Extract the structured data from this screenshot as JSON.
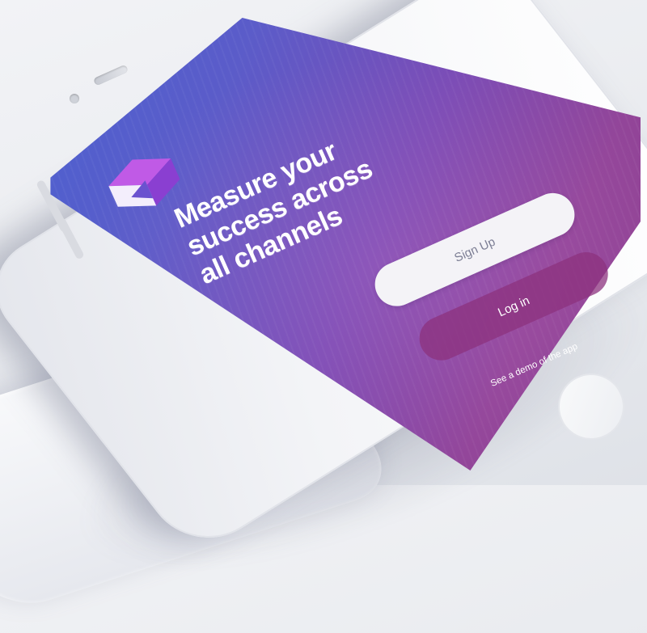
{
  "onboarding": {
    "headline_line1": "Measure your",
    "headline_line2": "success across",
    "headline_line3": "all channels",
    "signup_label": "Sign Up",
    "login_label": "Log in",
    "demo_link": "See a demo of the app"
  },
  "logo": {
    "name": "app-logo",
    "colors": {
      "light": "#ffffff",
      "top": "#c05ae6",
      "side": "#8a3fd1"
    }
  },
  "colors": {
    "gradient_start": "#4a62d1",
    "gradient_mid": "#7a4cb6",
    "gradient_end": "#8e3f8f",
    "signup_bg": "#f4f3f7",
    "signup_text": "#7d7f95",
    "login_bg": "#8c327d"
  }
}
